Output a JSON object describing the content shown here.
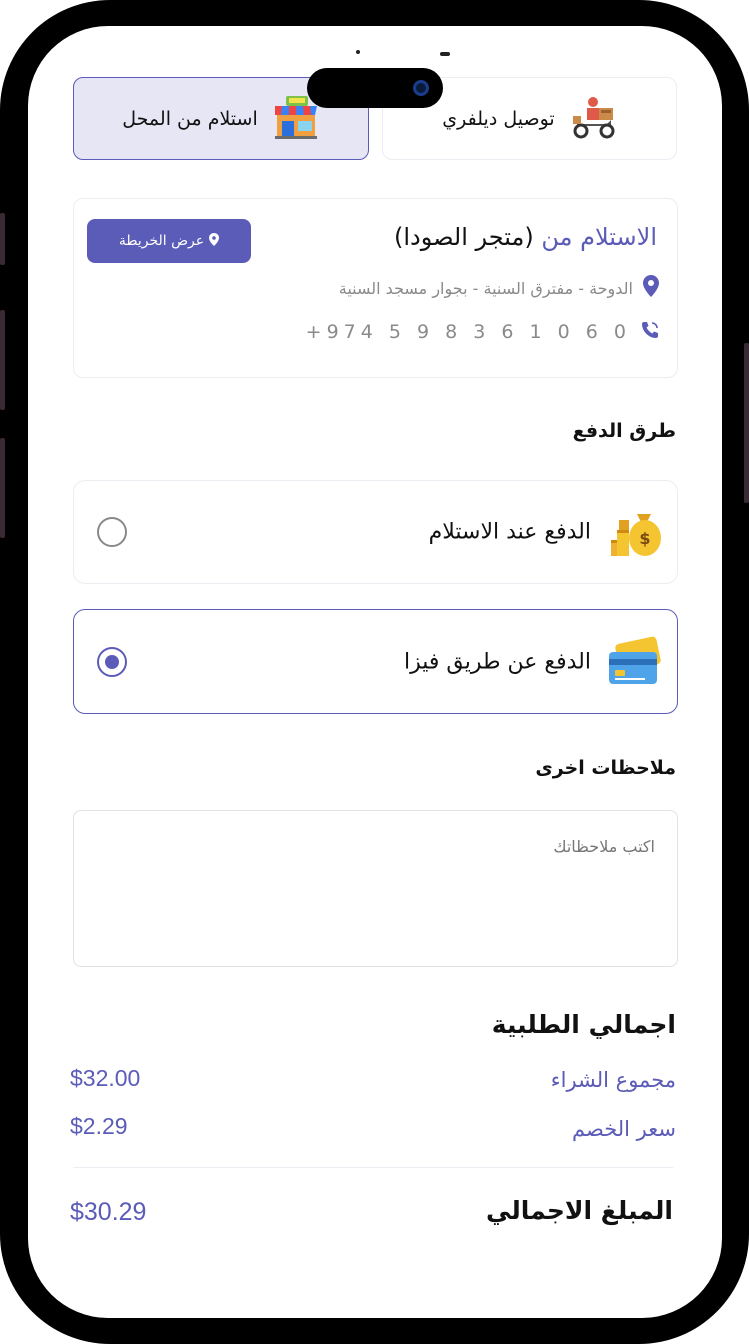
{
  "delivery_options": {
    "pickup_label": "استلام من المحل",
    "pickup_icon": "store-icon",
    "delivery_label": "توصيل ديلفري",
    "delivery_icon": "delivery-scooter-icon",
    "selected": "pickup"
  },
  "store": {
    "pickup_prefix": "الاستلام من",
    "store_name": "(متجر الصودا)",
    "map_button_label": "عرض الخريطة",
    "address": "الدوحة - مفترق السنية - بجوار مسجد السنية",
    "phone": "+974 5 9 8 3 6 1 0 6 0"
  },
  "payment": {
    "section_title": "طرق الدفع",
    "options": [
      {
        "label": "الدفع عند الاستلام",
        "icon": "money-bag-icon",
        "selected": false
      },
      {
        "label": "الدفع عن طريق فيزا",
        "icon": "credit-card-icon",
        "selected": true
      }
    ]
  },
  "notes": {
    "section_title": "ملاحظات اخرى",
    "placeholder": "اكتب ملاحظاتك",
    "value": ""
  },
  "summary": {
    "title": "اجمالي الطلبية",
    "subtotal_label": "مجموع الشراء",
    "subtotal_value": "$32.00",
    "discount_label": "سعر الخصم",
    "discount_value": "$2.29",
    "total_label": "المبلغ الاجمالي",
    "total_value": "$30.29"
  },
  "colors": {
    "accent": "#5b5bb8",
    "accent_light": "#e6e6f5",
    "muted_text": "#8a8a8a",
    "border": "#ececf2"
  }
}
